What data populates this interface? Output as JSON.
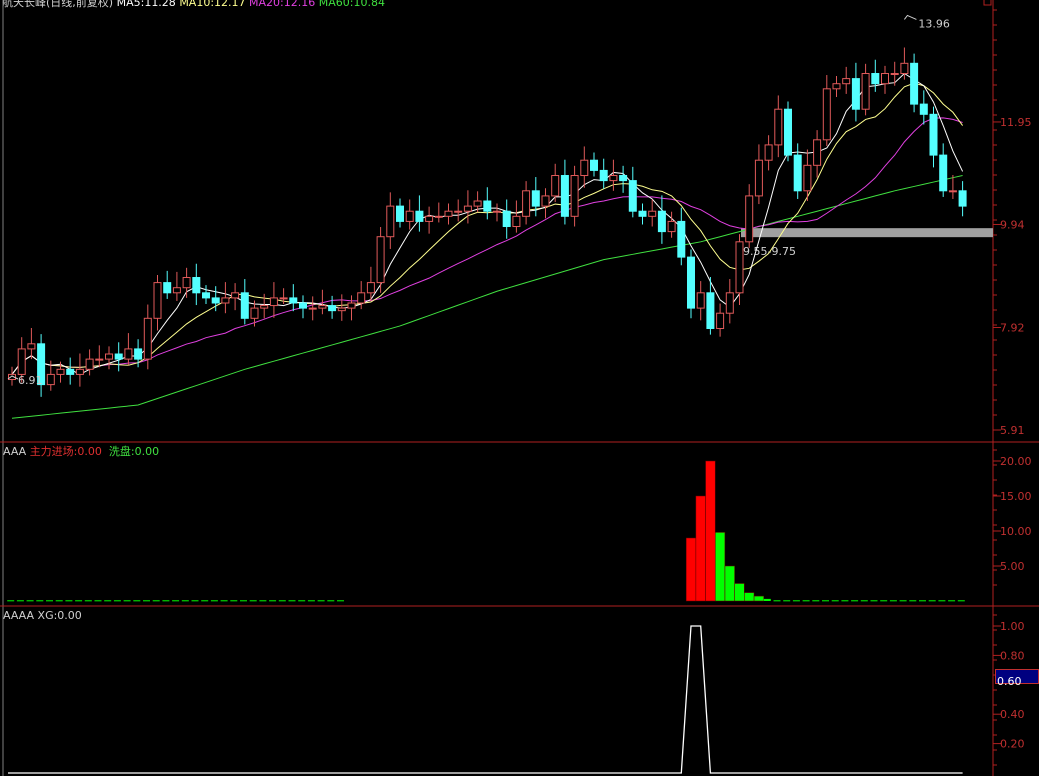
{
  "header": {
    "title": "航天长峰(日线,前复权)",
    "ma5": "MA5:11.28",
    "ma10": "MA10:12.17",
    "ma20": "MA20:12.16",
    "ma60": "MA60:10.84"
  },
  "panel1": {
    "name": "AAA",
    "zljc": "主力进场:0.00",
    "xp": "洗盘:0.00"
  },
  "panel2": {
    "name": "AAAA",
    "xg": "XG:0.00"
  },
  "colors": {
    "up": "#e05a5a",
    "down": "#54ffff",
    "ma5": "#ffffff",
    "ma10": "#ffff90",
    "ma20": "#e040e0",
    "ma60": "#40e040",
    "axis": "#b02020",
    "red_bar": "#ff0000",
    "green_bar": "#00ff00"
  },
  "chart_data": [
    {
      "type": "candlestick",
      "title": "航天长峰(日线,前复权)",
      "ylim": [
        5.7,
        14.3
      ],
      "yticks": [
        "11.95",
        "9.94",
        "7.92",
        "5.91"
      ],
      "ytick_values": [
        11.95,
        9.94,
        7.92,
        5.91
      ],
      "close": [
        7.0,
        7.5,
        7.6,
        6.8,
        7.0,
        7.1,
        7.0,
        7.1,
        7.3,
        7.3,
        7.4,
        7.3,
        7.5,
        7.3,
        8.1,
        8.8,
        8.6,
        8.7,
        8.9,
        8.6,
        8.5,
        8.4,
        8.5,
        8.6,
        8.1,
        8.3,
        8.35,
        8.5,
        8.5,
        8.4,
        8.3,
        8.3,
        8.35,
        8.25,
        8.3,
        8.4,
        8.6,
        8.8,
        9.7,
        10.3,
        10.0,
        10.2,
        10.0,
        10.1,
        10.1,
        10.2,
        10.2,
        10.3,
        10.4,
        10.2,
        10.2,
        9.9,
        10.1,
        10.6,
        10.3,
        10.5,
        10.9,
        10.1,
        10.9,
        11.2,
        11.0,
        10.8,
        10.9,
        10.8,
        10.2,
        10.1,
        10.2,
        9.8,
        10.0,
        9.3,
        8.3,
        8.6,
        7.9,
        8.2,
        8.6,
        9.6,
        10.5,
        11.2,
        11.5,
        12.2,
        11.3,
        10.6,
        11.1,
        11.6,
        12.6,
        12.7,
        12.8,
        12.2,
        12.9,
        12.7,
        12.9,
        12.9,
        13.1,
        12.3,
        12.1,
        11.3,
        10.6,
        10.6,
        10.3
      ],
      "first_open": 6.9,
      "ma60_samples": {
        "index": [
          0,
          13,
          24,
          40,
          50,
          61,
          71,
          81,
          91,
          98
        ],
        "value": [
          6.14,
          6.4,
          7.1,
          7.95,
          8.63,
          9.25,
          9.6,
          10.1,
          10.6,
          10.9
        ]
      },
      "annotations": {
        "high": "13.96",
        "low": "6.91",
        "zone": "9.55-9.75"
      },
      "zone": [
        9.55,
        9.75
      ],
      "high_value": 13.96,
      "high_index": 92,
      "low_value": 6.91,
      "low_index": 0
    },
    {
      "type": "bar",
      "title": "AAA",
      "ylim": [
        0,
        21
      ],
      "yticks": [
        "20.00",
        "15.00",
        "10.00",
        "5.00"
      ],
      "ytick_values": [
        20,
        15,
        10,
        5
      ],
      "series": [
        {
          "name": "主力进场",
          "sparse": {
            "70": 9,
            "71": 15,
            "72": 20
          }
        },
        {
          "name": "洗盘",
          "range_value": [
            [
              0,
              34,
              0.1
            ],
            [
              79,
              98,
              0.1
            ]
          ],
          "sparse": {
            "73": 9.8,
            "74": 5.0,
            "75": 2.5,
            "76": 1.2,
            "77": 0.7,
            "78": 0.3
          }
        }
      ]
    },
    {
      "type": "line",
      "title": "AAAA",
      "ylim": [
        0,
        1.1
      ],
      "yticks": [
        "1.00",
        "0.80",
        "0.40",
        "0.20"
      ],
      "ytick_values": [
        1.0,
        0.8,
        0.4,
        0.2
      ],
      "cursor_value": "0.60",
      "series": [
        {
          "name": "XG",
          "ones": [
            70,
            71
          ]
        }
      ]
    }
  ]
}
